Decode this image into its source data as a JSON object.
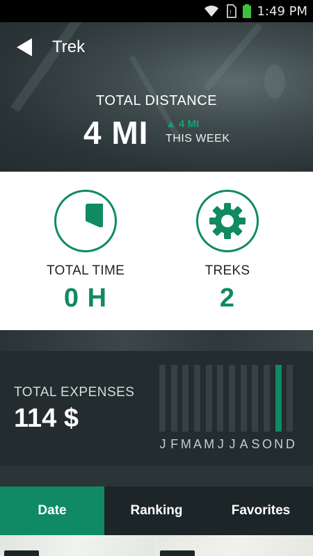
{
  "status_bar": {
    "time": "1:49 PM",
    "icons": [
      "wifi-icon",
      "no-sim-icon",
      "battery-icon"
    ]
  },
  "header": {
    "title": "Trek",
    "back_icon": "back-arrow-icon"
  },
  "distance": {
    "label": "TOTAL DISTANCE",
    "value": "4 MI",
    "delta": "▲ 4 MI",
    "period": "THIS WEEK"
  },
  "stats": [
    {
      "label": "TOTAL TIME",
      "value": "0 H",
      "icon": "pie-clock-icon"
    },
    {
      "label": "TREKS",
      "value": "2",
      "icon": "gear-icon"
    }
  ],
  "expenses": {
    "label": "TOTAL EXPENSES",
    "value": "114 $",
    "months": [
      "J",
      "F",
      "M",
      "A",
      "M",
      "J",
      "J",
      "A",
      "S",
      "O",
      "N",
      "D"
    ],
    "active_month_index": 10
  },
  "tabs": [
    {
      "label": "Date",
      "active": true
    },
    {
      "label": "Ranking",
      "active": false
    },
    {
      "label": "Favorites",
      "active": false
    }
  ],
  "colors": {
    "accent": "#0f8a63",
    "dark": "#232c2e",
    "delta_green": "#16a374"
  }
}
